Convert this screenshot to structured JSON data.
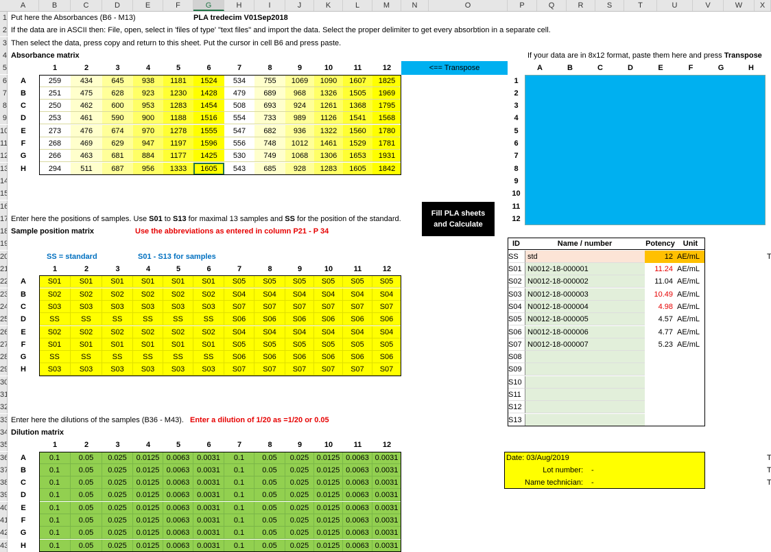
{
  "columns": [
    "A",
    "B",
    "C",
    "D",
    "E",
    "F",
    "G",
    "H",
    "I",
    "J",
    "K",
    "L",
    "M",
    "N",
    "O",
    "P",
    "Q",
    "R",
    "S",
    "T",
    "U",
    "V",
    "W",
    "X"
  ],
  "selected_column": "G",
  "row_numbers": [
    "1",
    "2",
    "3",
    "4",
    "5",
    "6",
    "7",
    "8",
    "9",
    "10",
    "11",
    "12",
    "13",
    "14",
    "15",
    "16",
    "17",
    "18",
    "19",
    "20",
    "21",
    "22",
    "23",
    "24",
    "25",
    "26",
    "27",
    "28",
    "29",
    "30",
    "31",
    "32",
    "33",
    "34",
    "35",
    "36",
    "37",
    "38",
    "39",
    "40",
    "41",
    "42",
    "43"
  ],
  "texts": {
    "line1": "Put here the Absorbances (B6 - M13)",
    "title": "PLA tredecim V01Sep2018",
    "line2": "If the data are in ASCII then: File, open, select in 'files of type' \"text files\" and import the data. Select the proper delimiter to get every absorbtion in a separate cell.",
    "line3": "Then select the data, press copy and return to this sheet. Put the cursor in cell B6 and press paste.",
    "absorbance_heading": "Absorbance matrix",
    "transpose_button": "<== Transpose",
    "transpose_note_1": "If your data are in 8x12 format, paste them here and press ",
    "transpose_note_2": "Transpose",
    "positions_note_1": "Enter here the positions of samples. Use ",
    "positions_note_2": "S01",
    "positions_note_3": " to ",
    "positions_note_4": "S13",
    "positions_note_5": " for maximal 13 samples and ",
    "positions_note_6": "SS",
    "positions_note_7": " for the position of the standard.",
    "sample_heading": "Sample position matrix",
    "abbr_note": "Use the abbreviations as entered in column P21 - P 34",
    "fill_button_1": "Fill PLA sheets",
    "fill_button_2": "and Calculate",
    "ss_label": "SS = standard",
    "s_label": "S01 - S13 for samples",
    "dilution_note": "Enter here the dilutions of the samples (B36 - M43).",
    "dilution_example": "Enter a dilution of 1/20 as =1/20 or 0.05",
    "dilution_heading": "Dilution matrix",
    "date": "Date: 03/Aug/2019",
    "lot": "Lot number:",
    "lot_value": "-",
    "tech": "Name technician:",
    "tech_value": "-"
  },
  "col_numbers": [
    "1",
    "2",
    "3",
    "4",
    "5",
    "6",
    "7",
    "8",
    "9",
    "10",
    "11",
    "12"
  ],
  "row_letters": [
    "A",
    "B",
    "C",
    "D",
    "E",
    "F",
    "G",
    "H"
  ],
  "transpose_headers": [
    "A",
    "B",
    "C",
    "D",
    "E",
    "F",
    "G",
    "H"
  ],
  "transpose_rows": [
    "1",
    "2",
    "3",
    "4",
    "5",
    "6",
    "7",
    "8",
    "9",
    "10",
    "11",
    "12"
  ],
  "absorbance": [
    [
      "259",
      "434",
      "645",
      "938",
      "1181",
      "1524",
      "534",
      "755",
      "1069",
      "1090",
      "1607",
      "1825"
    ],
    [
      "251",
      "475",
      "628",
      "923",
      "1230",
      "1428",
      "479",
      "689",
      "968",
      "1326",
      "1505",
      "1969"
    ],
    [
      "250",
      "462",
      "600",
      "953",
      "1283",
      "1454",
      "508",
      "693",
      "924",
      "1261",
      "1368",
      "1795"
    ],
    [
      "253",
      "461",
      "590",
      "900",
      "1188",
      "1516",
      "554",
      "733",
      "989",
      "1126",
      "1541",
      "1568"
    ],
    [
      "273",
      "476",
      "674",
      "970",
      "1278",
      "1555",
      "547",
      "682",
      "936",
      "1322",
      "1560",
      "1780"
    ],
    [
      "268",
      "469",
      "629",
      "947",
      "1197",
      "1596",
      "556",
      "748",
      "1012",
      "1461",
      "1529",
      "1781"
    ],
    [
      "266",
      "463",
      "681",
      "884",
      "1177",
      "1425",
      "530",
      "749",
      "1068",
      "1306",
      "1653",
      "1931"
    ],
    [
      "294",
      "511",
      "687",
      "956",
      "1333",
      "1605",
      "543",
      "685",
      "928",
      "1283",
      "1605",
      "1842"
    ]
  ],
  "positions": [
    [
      "S01",
      "S01",
      "S01",
      "S01",
      "S01",
      "S01",
      "S05",
      "S05",
      "S05",
      "S05",
      "S05",
      "S05"
    ],
    [
      "S02",
      "S02",
      "S02",
      "S02",
      "S02",
      "S02",
      "S04",
      "S04",
      "S04",
      "S04",
      "S04",
      "S04"
    ],
    [
      "S03",
      "S03",
      "S03",
      "S03",
      "S03",
      "S03",
      "S07",
      "S07",
      "S07",
      "S07",
      "S07",
      "S07"
    ],
    [
      "SS",
      "SS",
      "SS",
      "SS",
      "SS",
      "SS",
      "S06",
      "S06",
      "S06",
      "S06",
      "S06",
      "S06"
    ],
    [
      "S02",
      "S02",
      "S02",
      "S02",
      "S02",
      "S02",
      "S04",
      "S04",
      "S04",
      "S04",
      "S04",
      "S04"
    ],
    [
      "S01",
      "S01",
      "S01",
      "S01",
      "S01",
      "S01",
      "S05",
      "S05",
      "S05",
      "S05",
      "S05",
      "S05"
    ],
    [
      "SS",
      "SS",
      "SS",
      "SS",
      "SS",
      "SS",
      "S06",
      "S06",
      "S06",
      "S06",
      "S06",
      "S06"
    ],
    [
      "S03",
      "S03",
      "S03",
      "S03",
      "S03",
      "S03",
      "S07",
      "S07",
      "S07",
      "S07",
      "S07",
      "S07"
    ]
  ],
  "dilution_row": [
    "0.1",
    "0.05",
    "0.025",
    "0.0125",
    "0.0063",
    "0.0031",
    "0.1",
    "0.05",
    "0.025",
    "0.0125",
    "0.0063",
    "0.0031"
  ],
  "id_table": {
    "headers": [
      "ID",
      "Name / number",
      "Potency",
      "Unit"
    ],
    "rows": [
      {
        "id": "SS",
        "name": "std",
        "potency": "12",
        "unit": "AE/mL"
      },
      {
        "id": "S01",
        "name": "N0012-18-000001",
        "potency": "11.24",
        "unit": "AE/mL"
      },
      {
        "id": "S02",
        "name": "N0012-18-000002",
        "potency": "11.04",
        "unit": "AE/mL"
      },
      {
        "id": "S03",
        "name": "N0012-18-000003",
        "potency": "10.49",
        "unit": "AE/mL"
      },
      {
        "id": "S04",
        "name": "N0012-18-000004",
        "potency": "4.98",
        "unit": "AE/mL"
      },
      {
        "id": "S05",
        "name": "N0012-18-000005",
        "potency": "4.57",
        "unit": "AE/mL"
      },
      {
        "id": "S06",
        "name": "N0012-18-000006",
        "potency": "4.77",
        "unit": "AE/mL"
      },
      {
        "id": "S07",
        "name": "N0012-18-000007",
        "potency": "5.23",
        "unit": "AE/mL"
      },
      {
        "id": "S08",
        "name": "",
        "potency": "",
        "unit": ""
      },
      {
        "id": "S09",
        "name": "",
        "potency": "",
        "unit": ""
      },
      {
        "id": "S10",
        "name": "",
        "potency": "",
        "unit": ""
      },
      {
        "id": "S11",
        "name": "",
        "potency": "",
        "unit": ""
      },
      {
        "id": "S12",
        "name": "",
        "potency": "",
        "unit": ""
      },
      {
        "id": "S13",
        "name": "",
        "potency": "",
        "unit": ""
      }
    ]
  },
  "red_potency": [
    "11.24",
    "10.49",
    "4.98"
  ],
  "cut_off_text": "T",
  "colors": {
    "yellow": "#ffff00",
    "green": "#92d050",
    "cyan": "#00b0f0",
    "orange": "#ffc000",
    "peach": "#fce4d6",
    "light_green": "#e2efda"
  }
}
